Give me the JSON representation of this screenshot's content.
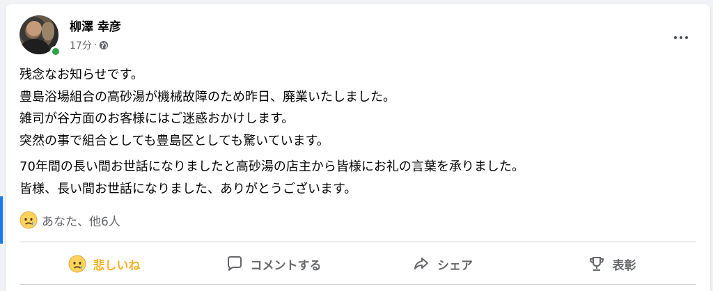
{
  "post": {
    "author": "柳澤 幸彦",
    "time": "17分",
    "separator": "·",
    "privacy_icon": "globe-icon",
    "more_icon": "more-options-icon",
    "paragraphs": [
      [
        "残念なお知らせです。",
        "豊島浴場組合の高砂湯が機械故障のため昨日、廃業いたしました。",
        "雑司が谷方面のお客様にはご迷惑おかけします。",
        "突然の事で組合としても豊島区としても驚いています。"
      ],
      [
        "70年間の長い間お世話になりましたと高砂湯の店主から皆様にお礼の言葉を承りました。",
        "皆様、長い間お世話になりました、ありがとうございます。"
      ]
    ],
    "reactions": {
      "icon": "sad-emoji-icon",
      "text": "あなた、他6人"
    },
    "actions": {
      "reaction": "悲しいね",
      "comment": "コメントする",
      "share": "シェア",
      "award": "表彰"
    }
  },
  "colors": {
    "accent_blue": "#1877f2",
    "reaction_active": "#f7b125",
    "online_green": "#31a24c",
    "secondary_text": "#65676b"
  }
}
